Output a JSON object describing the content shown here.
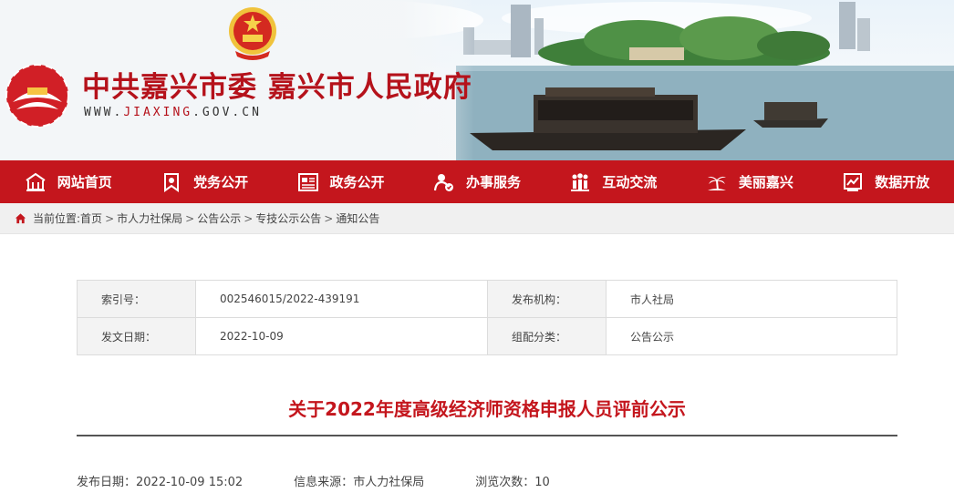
{
  "header": {
    "site_title": "中共嘉兴市委 嘉兴市人民政府",
    "site_url_prefix": "WWW.",
    "site_url_domain": "JIAXING",
    "site_url_suffix": ".GOV.CN"
  },
  "nav": {
    "items": [
      {
        "label": "网站首页",
        "icon": "home-icon"
      },
      {
        "label": "党务公开",
        "icon": "party-flag-icon"
      },
      {
        "label": "政务公开",
        "icon": "document-board-icon"
      },
      {
        "label": "办事服务",
        "icon": "service-person-icon"
      },
      {
        "label": "互动交流",
        "icon": "people-group-icon"
      },
      {
        "label": "美丽嘉兴",
        "icon": "palm-tree-icon"
      },
      {
        "label": "数据开放",
        "icon": "data-chart-icon"
      }
    ]
  },
  "breadcrumb": {
    "prefix": "当前位置:",
    "items": [
      "首页",
      "市人力社保局",
      "公告公示",
      "专技公示公告",
      "通知公告"
    ],
    "separator": ">"
  },
  "info": {
    "index_label": "索引号：",
    "index_value": "002546015/2022-439191",
    "publisher_label": "发布机构：",
    "publisher_value": "市人社局",
    "date_label": "发文日期：",
    "date_value": "2022-10-09",
    "category_label": "组配分类：",
    "category_value": "公告公示"
  },
  "article": {
    "title": "关于2022年度高级经济师资格申报人员评前公示",
    "publish_date_label": "发布日期：",
    "publish_date": "2022-10-09 15:02",
    "source_label": "信息来源：",
    "source": "市人力社保局",
    "views_label": "浏览次数：",
    "views": "10"
  },
  "colors": {
    "brand_red": "#c4161d",
    "title_red": "#b5121b"
  }
}
